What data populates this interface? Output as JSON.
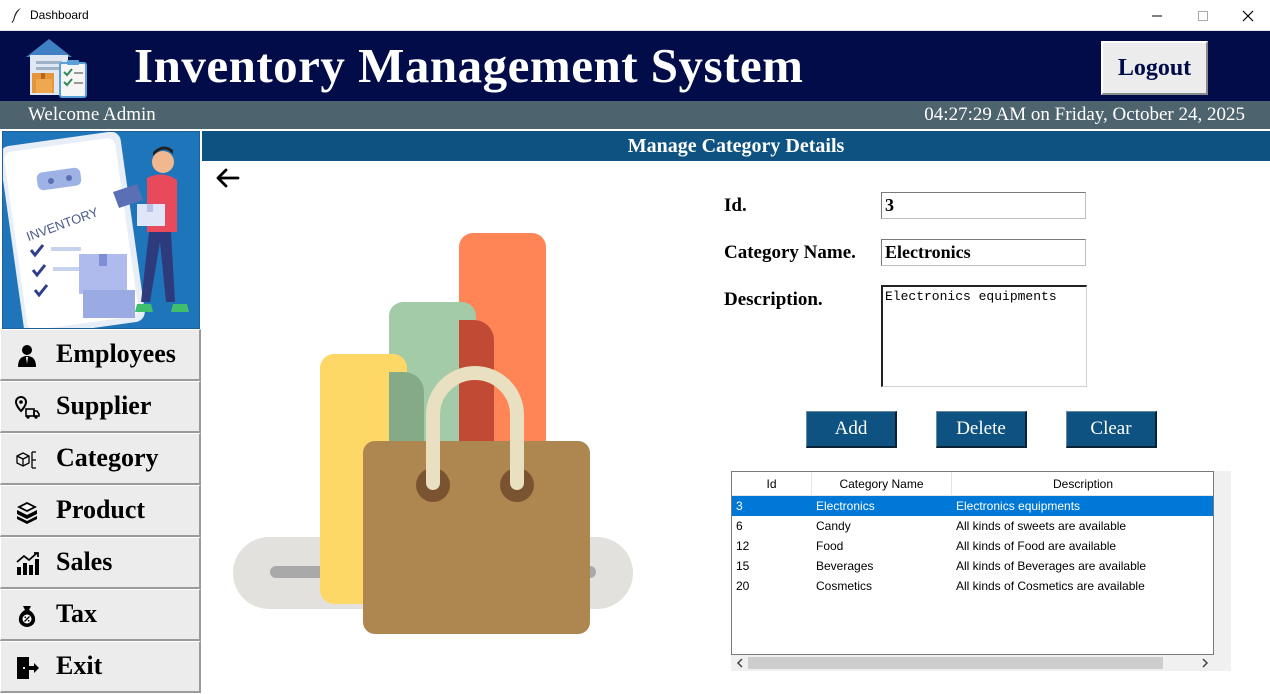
{
  "window": {
    "title": "Dashboard"
  },
  "header": {
    "app_title": "Inventory Management System",
    "logout_label": "Logout"
  },
  "subbar": {
    "welcome": "Welcome Admin",
    "clock": "04:27:29 AM on Friday, October 24, 2025"
  },
  "sidebar": {
    "image_label": "INVENTORY",
    "items": [
      {
        "label": "Employees",
        "icon": "employee-icon"
      },
      {
        "label": "Supplier",
        "icon": "supplier-icon"
      },
      {
        "label": "Category",
        "icon": "category-icon"
      },
      {
        "label": "Product",
        "icon": "product-icon"
      },
      {
        "label": "Sales",
        "icon": "sales-icon"
      },
      {
        "label": "Tax",
        "icon": "tax-icon"
      },
      {
        "label": "Exit",
        "icon": "exit-icon"
      }
    ]
  },
  "main": {
    "section_title": "Manage Category Details",
    "form": {
      "id_label": "Id.",
      "id_value": "3",
      "name_label": "Category Name.",
      "name_value": "Electronics",
      "desc_label": "Description.",
      "desc_value": "Electronics equipments"
    },
    "buttons": {
      "add": "Add",
      "delete": "Delete",
      "clear": "Clear"
    },
    "table": {
      "columns": [
        "Id",
        "Category Name",
        "Description"
      ],
      "rows": [
        [
          "3",
          "Electronics",
          "Electronics equipments"
        ],
        [
          "6",
          "Candy",
          "All kinds of sweets are available"
        ],
        [
          "12",
          "Food",
          "All kinds of Food are available"
        ],
        [
          "15",
          "Beverages",
          "All kinds of Beverages are available"
        ],
        [
          "20",
          "Cosmetics",
          "All kinds of Cosmetics are available"
        ]
      ],
      "selected_row": 0
    }
  },
  "colors": {
    "header_bg": "#010c48",
    "subbar_bg": "#4d636d",
    "section_bg": "#0e5281",
    "button_bg": "#0e5281",
    "selection": "#0078d7"
  }
}
